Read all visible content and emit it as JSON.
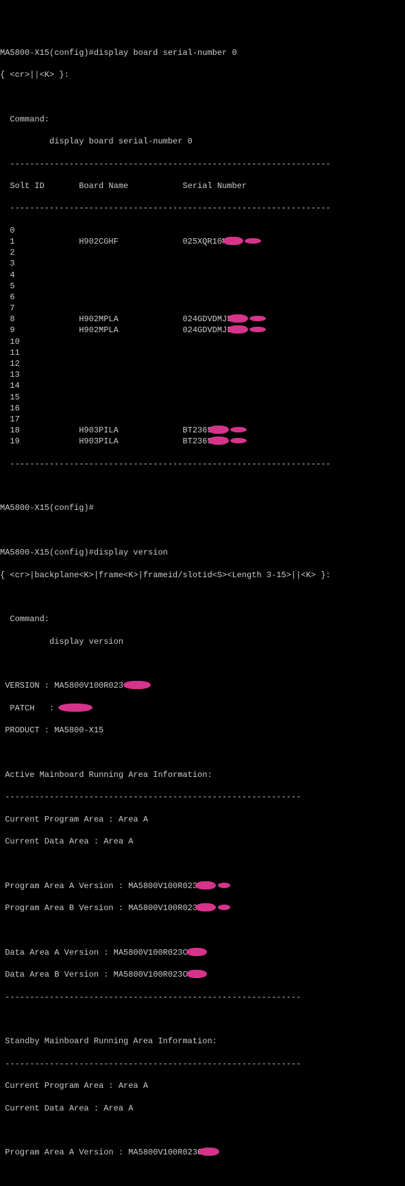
{
  "prompt1": "MA5800-X15(config)#display board serial-number 0",
  "syntax1": "{ <cr>||<K> }:",
  "cmd_label": "  Command:",
  "cmd1": "          display board serial-number 0",
  "dashes_short": "  -----------------------------------------------------------------",
  "header": "  Solt ID       Board Name           Serial Number",
  "slots": [
    {
      "id": "0",
      "board": "",
      "serial": ""
    },
    {
      "id": "1",
      "board": "H902CGHF",
      "serial": "025XQR10M"
    },
    {
      "id": "2",
      "board": "",
      "serial": ""
    },
    {
      "id": "3",
      "board": "",
      "serial": ""
    },
    {
      "id": "4",
      "board": "",
      "serial": ""
    },
    {
      "id": "5",
      "board": "",
      "serial": ""
    },
    {
      "id": "6",
      "board": "",
      "serial": ""
    },
    {
      "id": "7",
      "board": "",
      "serial": ""
    },
    {
      "id": "8",
      "board": "H902MPLA",
      "serial": "024GDVDMJ5"
    },
    {
      "id": "9",
      "board": "H902MPLA",
      "serial": "024GDVDMJ5"
    },
    {
      "id": "10",
      "board": "",
      "serial": ""
    },
    {
      "id": "11",
      "board": "",
      "serial": ""
    },
    {
      "id": "12",
      "board": "",
      "serial": ""
    },
    {
      "id": "13",
      "board": "",
      "serial": ""
    },
    {
      "id": "14",
      "board": "",
      "serial": ""
    },
    {
      "id": "15",
      "board": "",
      "serial": ""
    },
    {
      "id": "16",
      "board": "",
      "serial": ""
    },
    {
      "id": "17",
      "board": "",
      "serial": ""
    },
    {
      "id": "18",
      "board": "H903PILA",
      "serial": "BT2369"
    },
    {
      "id": "19",
      "board": "H903PILA",
      "serial": "BT2369"
    }
  ],
  "prompt2": "MA5800-X15(config)#",
  "prompt3": "MA5800-X15(config)#display version",
  "syntax2": "{ <cr>|backplane<K>|frame<K>|frameid/slotid<S><Length 3-15>||<K> }:",
  "cmd2": "          display version",
  "version_line": " VERSION : MA5800V100R023",
  "patch_line": "  PATCH   : ",
  "product_line": " PRODUCT : MA5800-X15",
  "active_hdr": " Active Mainboard Running Area Information:",
  "dashes_long": " ------------------------------------------------------------",
  "cur_prog": " Current Program Area : Area A",
  "cur_data": " Current Data Area : Area A",
  "prog_a": " Program Area A Version : MA5800V100R023",
  "prog_b": " Program Area B Version : MA5800V100R023",
  "data_a": " Data Area A Version : MA5800V100R023C",
  "data_b": " Data Area B Version : MA5800V100R023C",
  "standby_hdr": " Standby Mainboard Running Area Information:",
  "prog_a2": " Program Area A Version : MA5800V100R023C"
}
